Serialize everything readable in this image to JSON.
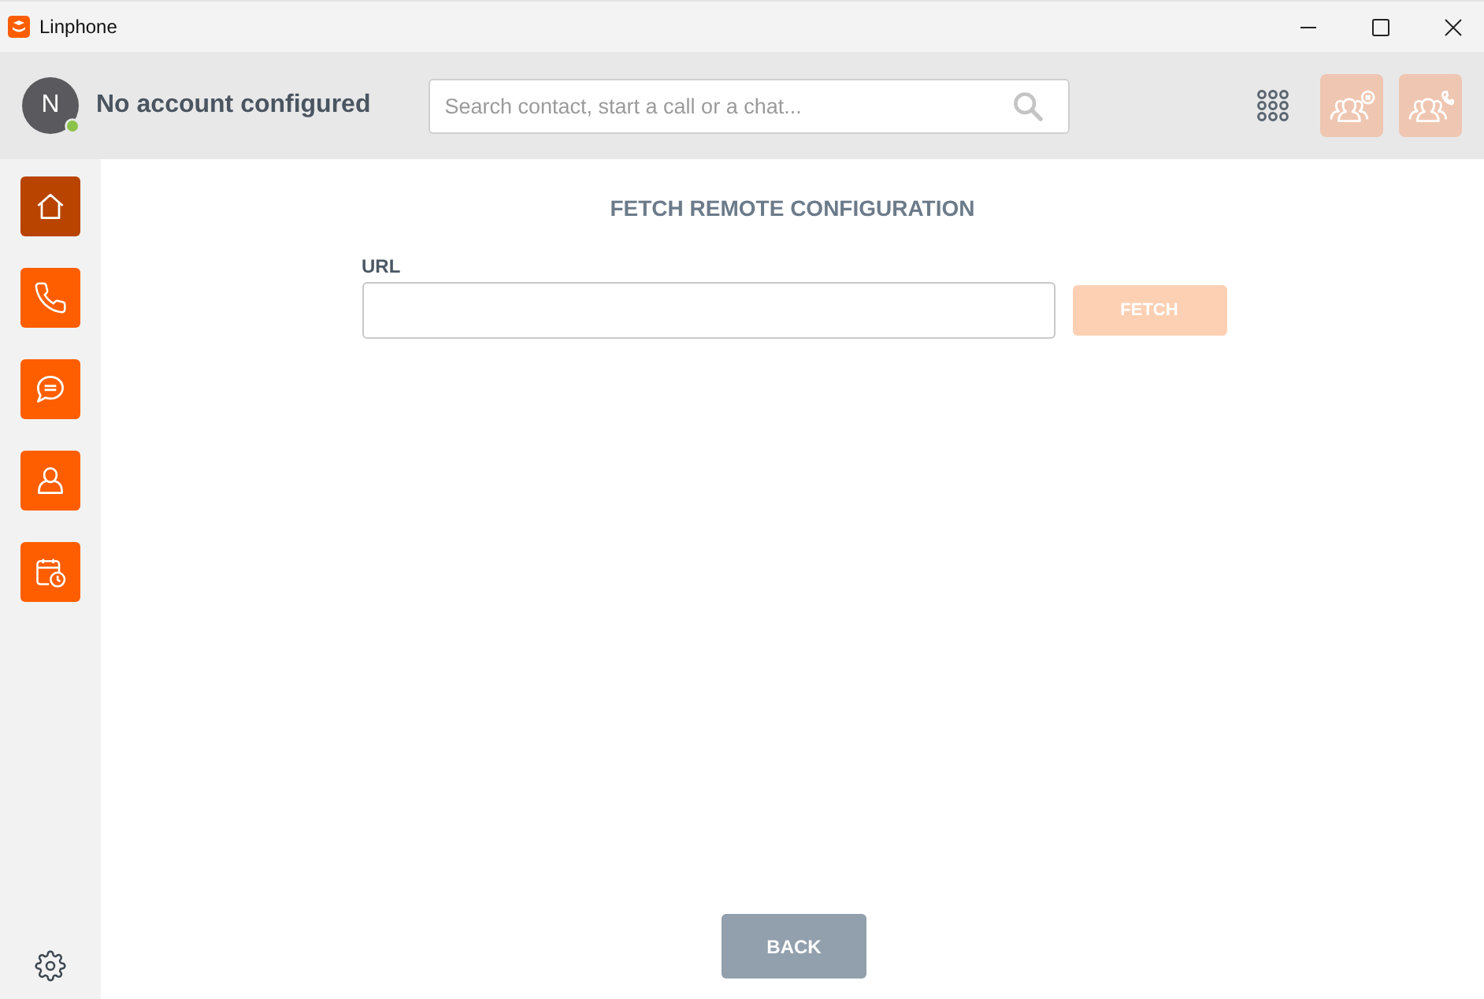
{
  "window": {
    "title": "Linphone"
  },
  "header": {
    "account": {
      "initial": "N",
      "name": "No account configured",
      "online": true
    },
    "search": {
      "placeholder": "Search contact, start a call or a chat..."
    },
    "actions": [
      {
        "kind": "dialpad"
      },
      {
        "kind": "group-chat"
      },
      {
        "kind": "group-call"
      }
    ]
  },
  "sidebar": {
    "items": [
      {
        "kind": "home",
        "selected": true
      },
      {
        "kind": "calls",
        "selected": false
      },
      {
        "kind": "chat",
        "selected": false
      },
      {
        "kind": "contacts",
        "selected": false
      },
      {
        "kind": "meetings",
        "selected": false
      }
    ]
  },
  "main": {
    "title": "FETCH REMOTE CONFIGURATION",
    "url_field": {
      "label": "URL"
    },
    "fetch_button": {
      "label": "FETCH",
      "disabled": true
    },
    "back_button": {
      "label": "BACK"
    }
  }
}
